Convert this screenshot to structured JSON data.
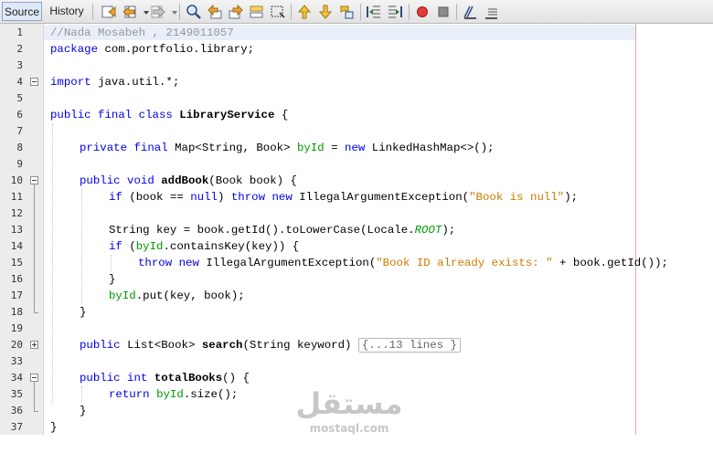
{
  "tabs": [
    {
      "label": "Source",
      "active": true
    },
    {
      "label": "History",
      "active": false
    }
  ],
  "toolbar_icons": [
    "last-edit-icon",
    "back-icon",
    "forward-icon",
    "find-selection-icon",
    "find-previous-icon",
    "find-next-icon",
    "toggle-highlight-icon",
    "toggle-rect-select-icon",
    "previous-bookmark-icon",
    "next-bookmark-icon",
    "toggle-bookmark-icon",
    "shift-left-icon",
    "shift-right-icon",
    "start-macro-icon",
    "stop-macro-icon",
    "comment-icon",
    "uncomment-icon"
  ],
  "colors": {
    "keyword": "#0000e6",
    "string": "#ce7b00",
    "comment": "#969696",
    "field": "#009900",
    "current_line": "#e9eff8",
    "margin": "#e0a8a8"
  },
  "editor": {
    "line_numbers": [
      "1",
      "2",
      "3",
      "4",
      "5",
      "6",
      "7",
      "8",
      "9",
      "10",
      "11",
      "12",
      "13",
      "14",
      "15",
      "16",
      "17",
      "18",
      "19",
      "20",
      "33",
      "34",
      "35",
      "36",
      "37"
    ],
    "folded_placeholder": "{...13 lines }",
    "lines": [
      {
        "n": "1",
        "indent": 0,
        "parts": [
          {
            "t": "//Nada Mosabeh , 2149011057",
            "c": "c"
          }
        ]
      },
      {
        "n": "2",
        "indent": 0,
        "parts": [
          {
            "t": "package ",
            "c": "k"
          },
          {
            "t": "com.portfolio.library;",
            "c": ""
          }
        ]
      },
      {
        "n": "3",
        "indent": 0,
        "parts": []
      },
      {
        "n": "4",
        "indent": 0,
        "parts": [
          {
            "t": "import ",
            "c": "k"
          },
          {
            "t": "java.util.*;",
            "c": ""
          }
        ]
      },
      {
        "n": "5",
        "indent": 0,
        "parts": []
      },
      {
        "n": "6",
        "indent": 0,
        "parts": [
          {
            "t": "public final class ",
            "c": "k"
          },
          {
            "t": "LibraryService",
            "c": "b"
          },
          {
            "t": " {",
            "c": ""
          }
        ]
      },
      {
        "n": "7",
        "indent": 0,
        "parts": []
      },
      {
        "n": "8",
        "indent": 1,
        "parts": [
          {
            "t": "private final ",
            "c": "k"
          },
          {
            "t": "Map<String, Book> ",
            "c": ""
          },
          {
            "t": "byId",
            "c": "fld"
          },
          {
            "t": " = ",
            "c": ""
          },
          {
            "t": "new ",
            "c": "k"
          },
          {
            "t": "LinkedHashMap<>();",
            "c": ""
          }
        ]
      },
      {
        "n": "9",
        "indent": 0,
        "parts": []
      },
      {
        "n": "10",
        "indent": 1,
        "parts": [
          {
            "t": "public void ",
            "c": "k"
          },
          {
            "t": "addBook",
            "c": "b"
          },
          {
            "t": "(Book book) {",
            "c": ""
          }
        ]
      },
      {
        "n": "11",
        "indent": 2,
        "parts": [
          {
            "t": "if ",
            "c": "k"
          },
          {
            "t": "(book == ",
            "c": ""
          },
          {
            "t": "null",
            "c": "k"
          },
          {
            "t": ") ",
            "c": ""
          },
          {
            "t": "throw new ",
            "c": "k"
          },
          {
            "t": "IllegalArgumentException(",
            "c": ""
          },
          {
            "t": "\"Book is null\"",
            "c": "s"
          },
          {
            "t": ");",
            "c": ""
          }
        ]
      },
      {
        "n": "12",
        "indent": 0,
        "parts": []
      },
      {
        "n": "13",
        "indent": 2,
        "parts": [
          {
            "t": "String key = book.getId().toLowerCase(Locale.",
            "c": ""
          },
          {
            "t": "ROOT",
            "c": "cst"
          },
          {
            "t": ");",
            "c": ""
          }
        ]
      },
      {
        "n": "14",
        "indent": 2,
        "parts": [
          {
            "t": "if ",
            "c": "k"
          },
          {
            "t": "(",
            "c": ""
          },
          {
            "t": "byId",
            "c": "fld"
          },
          {
            "t": ".containsKey(key)) {",
            "c": ""
          }
        ]
      },
      {
        "n": "15",
        "indent": 3,
        "parts": [
          {
            "t": "throw new ",
            "c": "k"
          },
          {
            "t": "IllegalArgumentException(",
            "c": ""
          },
          {
            "t": "\"Book ID already exists: \"",
            "c": "s"
          },
          {
            "t": " + book.getId());",
            "c": ""
          }
        ]
      },
      {
        "n": "16",
        "indent": 2,
        "parts": [
          {
            "t": "}",
            "c": ""
          }
        ]
      },
      {
        "n": "17",
        "indent": 2,
        "parts": [
          {
            "t": "byId",
            "c": "fld"
          },
          {
            "t": ".put(key, book);",
            "c": ""
          }
        ]
      },
      {
        "n": "18",
        "indent": 1,
        "parts": [
          {
            "t": "}",
            "c": ""
          }
        ]
      },
      {
        "n": "19",
        "indent": 0,
        "parts": []
      },
      {
        "n": "20",
        "indent": 1,
        "parts": [
          {
            "t": "public ",
            "c": "k"
          },
          {
            "t": "List<Book> ",
            "c": ""
          },
          {
            "t": "search",
            "c": "b"
          },
          {
            "t": "(String keyword) ",
            "c": ""
          }
        ],
        "folded": true
      },
      {
        "n": "33",
        "indent": 0,
        "parts": []
      },
      {
        "n": "34",
        "indent": 1,
        "parts": [
          {
            "t": "public int ",
            "c": "k"
          },
          {
            "t": "totalBooks",
            "c": "b"
          },
          {
            "t": "() {",
            "c": ""
          }
        ]
      },
      {
        "n": "35",
        "indent": 2,
        "parts": [
          {
            "t": "return ",
            "c": "k"
          },
          {
            "t": "byId",
            "c": "fld"
          },
          {
            "t": ".size();",
            "c": ""
          }
        ]
      },
      {
        "n": "36",
        "indent": 1,
        "parts": [
          {
            "t": "}",
            "c": ""
          }
        ]
      },
      {
        "n": "37",
        "indent": 0,
        "parts": [
          {
            "t": "}",
            "c": ""
          }
        ]
      }
    ]
  },
  "watermark": {
    "main": "مستقل",
    "sub": "mostaql.com"
  }
}
